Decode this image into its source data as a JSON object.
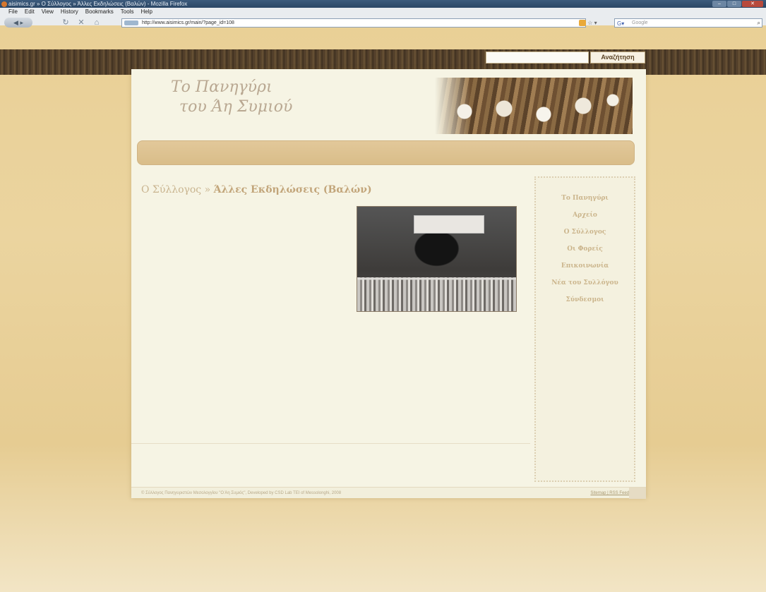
{
  "browser": {
    "window_title": "aisimics.gr » Ο Σύλλογος » Άλλες Εκδηλώσεις (Βαλών) - Mozilla Firefox",
    "menu": [
      "File",
      "Edit",
      "View",
      "History",
      "Bookmarks",
      "Tools",
      "Help"
    ],
    "url": "http://www.aisimics.gr/main/?page_id=108",
    "search_engine": "Google",
    "search_placeholder": "Google"
  },
  "site": {
    "search_button_label": "Αναζήτηση",
    "search_value": "",
    "logo_line1": "Το Πανηγύρι",
    "logo_line2": "του Άη Συμιού",
    "nav_band_text": "",
    "breadcrumb_parent": "Ο Σύλλογος »",
    "breadcrumb_current": "Άλλες Εκδηλώσεις (Βαλών)",
    "sidebar_items": [
      "Το Πανηγύρι",
      "Αρχείο",
      "Ο Σύλλογος",
      "Οι Φορείς",
      "Επικοινωνία",
      "Νέα του Συλλόγου",
      "Σύνδεσμοι"
    ],
    "footer_text": "© Σύλλογος Πανηγυριστών Μεσολογγίου \"Ο Άη Συμιός\", Developed by CSD Lab TEI of Messolonghi, 2008",
    "footer_links": "Sitemap | RSS Feed"
  },
  "colors": {
    "page_bg": "#f6f4e4",
    "body_bg": "#e9cf95",
    "nav_band": "#dcc08e",
    "accent_text": "#c2a57a"
  }
}
